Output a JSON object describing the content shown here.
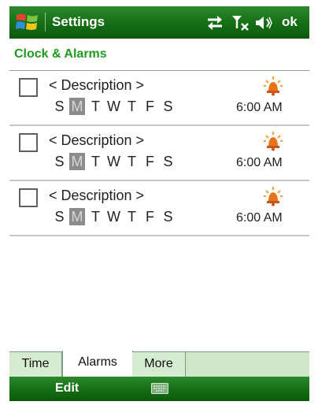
{
  "titlebar": {
    "title": "Settings",
    "ok_label": "ok",
    "icons": [
      "windows-start-icon",
      "sync-icon",
      "signal-off-icon",
      "volume-icon"
    ]
  },
  "section": {
    "title": "Clock & Alarms"
  },
  "alarms": [
    {
      "checked": false,
      "description": "< Description >",
      "days": [
        "S",
        "M",
        "T",
        "W",
        "T",
        "F",
        "S"
      ],
      "active_day_index": 1,
      "time": "6:00 AM",
      "icon": "alarm-bell-icon"
    },
    {
      "checked": false,
      "description": "< Description >",
      "days": [
        "S",
        "M",
        "T",
        "W",
        "T",
        "F",
        "S"
      ],
      "active_day_index": 1,
      "time": "6:00 AM",
      "icon": "alarm-bell-icon"
    },
    {
      "checked": false,
      "description": "< Description >",
      "days": [
        "S",
        "M",
        "T",
        "W",
        "T",
        "F",
        "S"
      ],
      "active_day_index": 1,
      "time": "6:00 AM",
      "icon": "alarm-bell-icon"
    }
  ],
  "tabs": [
    {
      "label": "Time",
      "active": false
    },
    {
      "label": "Alarms",
      "active": true
    },
    {
      "label": "More",
      "active": false
    }
  ],
  "softkeys": {
    "left_label": "Edit",
    "center_icon": "keyboard-icon"
  },
  "colors": {
    "bar_green": "#156d15",
    "section_title_green": "#1f9a1f",
    "tab_strip": "#cfe6c8",
    "active_day_bg": "#8c8c8c",
    "alarm_icon": "#e8741a"
  }
}
